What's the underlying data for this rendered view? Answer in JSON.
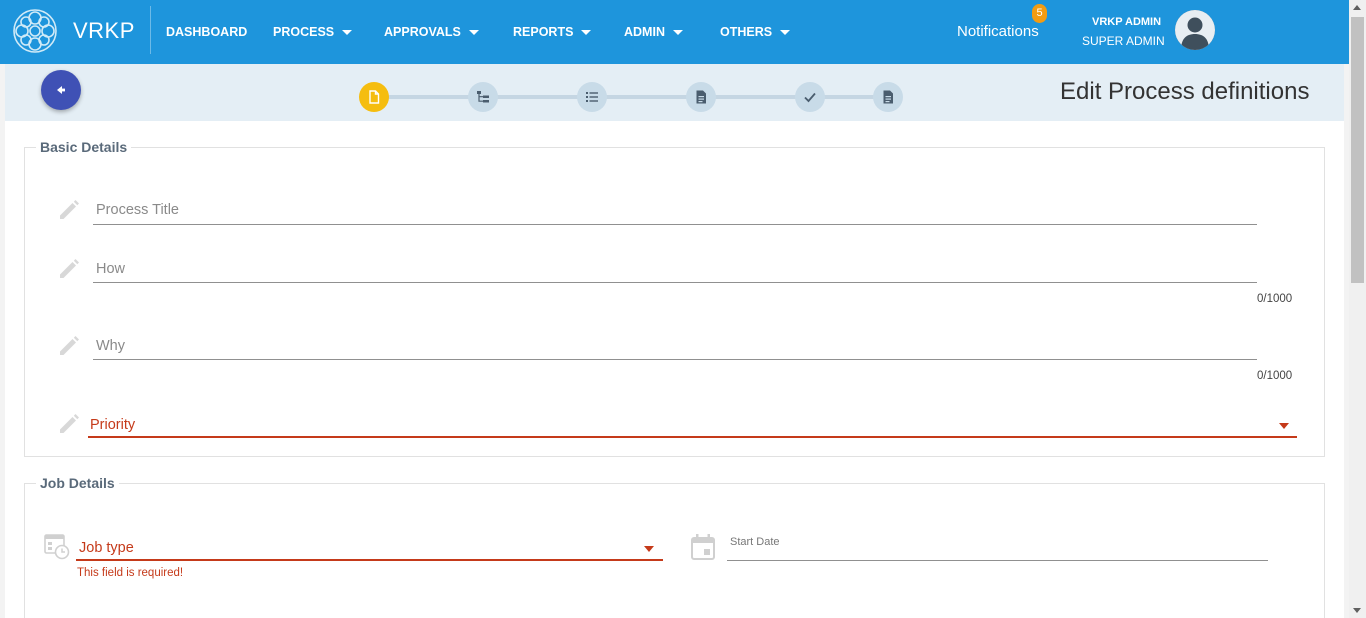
{
  "topbar": {
    "brand": "VRKP",
    "nav": [
      {
        "label": "DASHBOARD",
        "dropdown": false
      },
      {
        "label": "PROCESS",
        "dropdown": true
      },
      {
        "label": "APPROVALS",
        "dropdown": true
      },
      {
        "label": "REPORTS",
        "dropdown": true
      },
      {
        "label": "ADMIN",
        "dropdown": true
      },
      {
        "label": "OTHERS",
        "dropdown": true
      }
    ],
    "notifications_label": "Notifications",
    "notifications_count": "5",
    "user_name": "VRKP ADMIN",
    "user_role": "SUPER ADMIN"
  },
  "colors": {
    "topbar": "#1e95dc",
    "accent": "#3f51b5",
    "active_step": "#f5bd0f",
    "error": "#c53a1a"
  },
  "stepper": {
    "steps": [
      {
        "icon": "file-icon",
        "active": true
      },
      {
        "icon": "hierarchy-icon",
        "active": false
      },
      {
        "icon": "list-icon",
        "active": false
      },
      {
        "icon": "document-icon",
        "active": false
      },
      {
        "icon": "check-icon",
        "active": false
      },
      {
        "icon": "document-icon",
        "active": false
      }
    ]
  },
  "page": {
    "title": "Edit Process definitions"
  },
  "basic_details": {
    "legend": "Basic Details",
    "process_title": {
      "placeholder": "Process Title",
      "value": ""
    },
    "how": {
      "placeholder": "How",
      "value": "",
      "counter": "0/1000"
    },
    "why": {
      "placeholder": "Why",
      "value": "",
      "counter": "0/1000"
    },
    "priority": {
      "label": "Priority",
      "value": ""
    }
  },
  "job_details": {
    "legend": "Job Details",
    "job_type": {
      "label": "Job type",
      "error": "This field is required!"
    },
    "start_date": {
      "label": "Start Date",
      "value": ""
    }
  }
}
